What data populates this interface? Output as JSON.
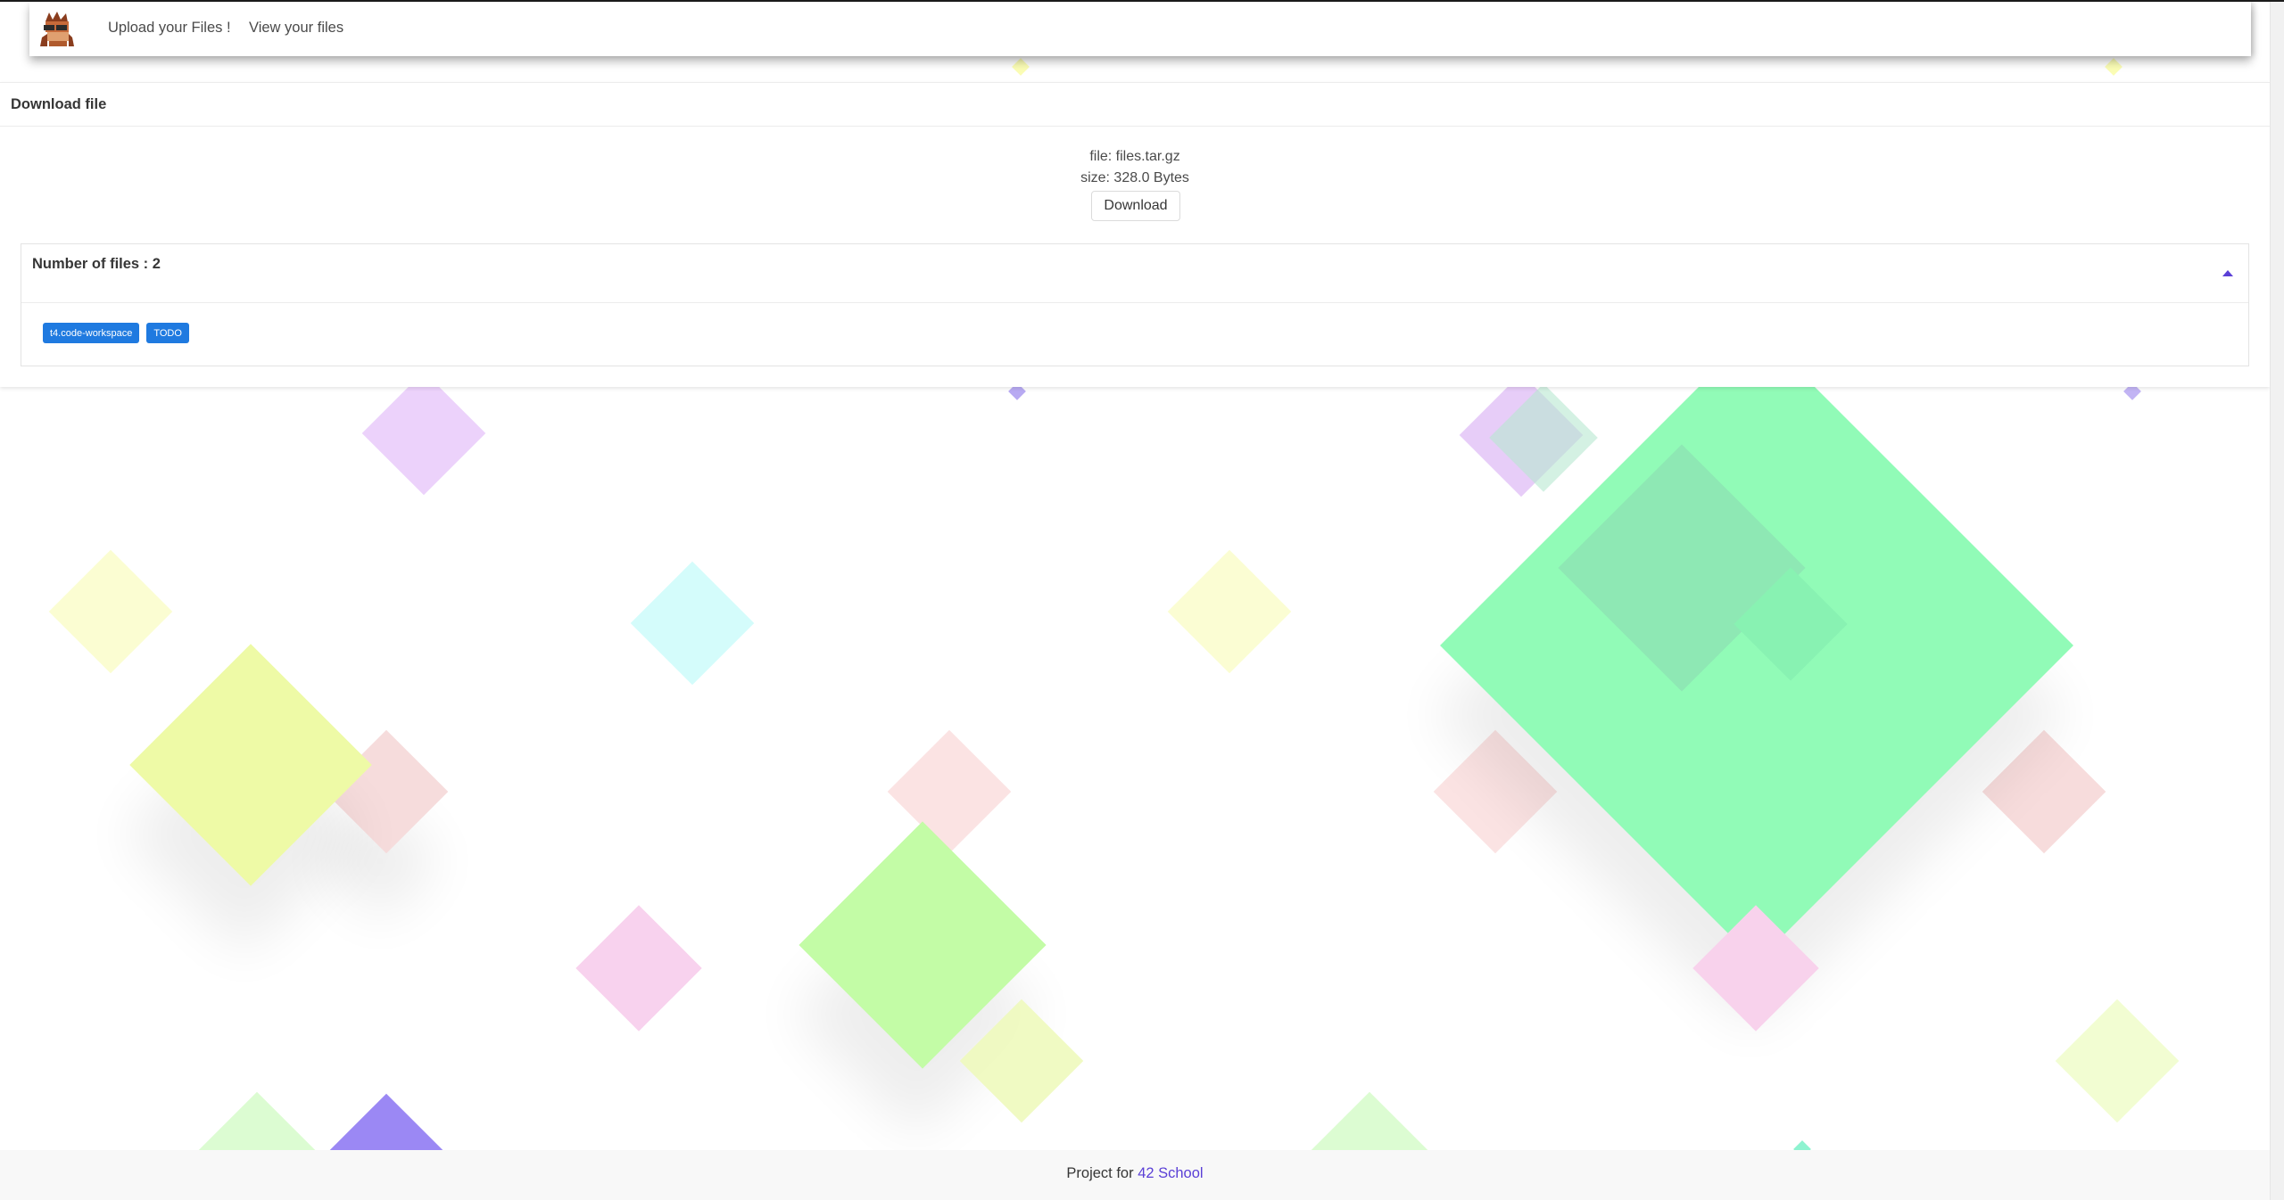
{
  "navbar": {
    "logo_icon": "hedgehog-logo-icon",
    "upload_link": "Upload your Files !",
    "view_link": "View your files"
  },
  "card": {
    "title": "Download file",
    "file_line": "file: files.tar.gz",
    "size_line": "size: 328.0 Bytes",
    "download_label": "Download",
    "files_panel": {
      "count_label": "Number of files : 2",
      "toggle_icon": "caret-up-icon",
      "tags": [
        "t4.code-workspace",
        "TODO"
      ]
    }
  },
  "footer": {
    "prefix": "Project for ",
    "link": "42 School"
  },
  "colors": {
    "accent": "#5a3fd6",
    "tag": "#1f7ae0"
  }
}
